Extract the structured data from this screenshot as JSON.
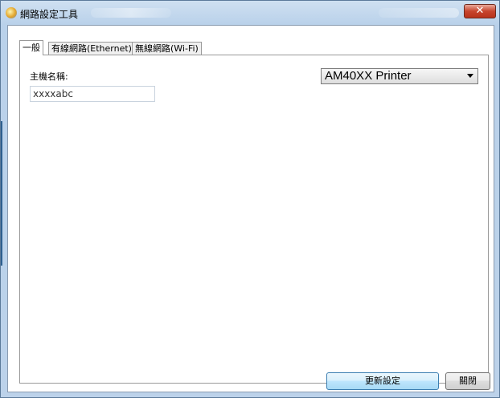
{
  "window": {
    "title": "網路設定工具",
    "close_symbol": "✕"
  },
  "tabs": [
    {
      "label": "一般",
      "active": true
    },
    {
      "label": "有線網路(Ethernet)",
      "active": false
    },
    {
      "label": "無線網路(Wi-Fi)",
      "active": false
    }
  ],
  "general": {
    "host_label": "主機名稱:",
    "host_value": "xxxxabc",
    "model_selected": "AM40XX Printer"
  },
  "buttons": {
    "update": "更新設定",
    "close": "關閉"
  },
  "colors": {
    "title_bar": "#b9d1ea",
    "close_button": "#c7442d",
    "default_button": "#bee6fd"
  }
}
